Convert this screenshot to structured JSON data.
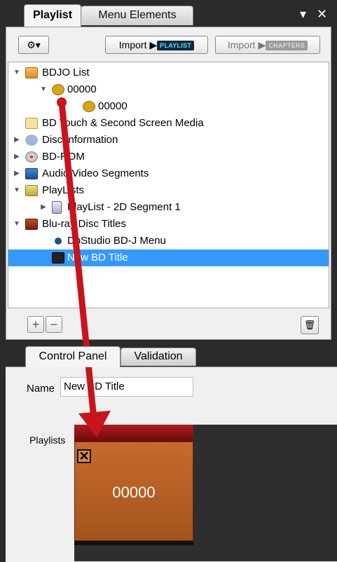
{
  "tabs": {
    "playlist": "Playlist",
    "menu_elements": "Menu Elements",
    "dropdown_glyph": "▾",
    "close_glyph": "✕"
  },
  "toolbar": {
    "gear_glyph": "⚙▾",
    "import_label": "Import",
    "import_playlist_tag": "PLAYLIST",
    "import_chapters_tag": "CHAPTERS"
  },
  "tree": {
    "bdjo_list": "BDJO List",
    "bdjo_00000": "00000",
    "bdjo_child_00000": "00000",
    "bd_touch": "BD Touch & Second Screen Media",
    "disc_information": "Disc Information",
    "bd_rom": "BD-ROM",
    "audio_video_segments": "Audio Video Segments",
    "playlists": "PlayLists",
    "playlist_2d": "PlayList - 2D Segment 1",
    "bluray_titles": "Blu-ray Disc Titles",
    "dostudio_menu": "DoStudio BD-J Menu",
    "new_bd_title": "New BD Title"
  },
  "bottom_buttons": {
    "add": "+",
    "remove": "−",
    "trash": "🗑"
  },
  "bottom_tabs": {
    "control_panel": "Control Panel",
    "validation": "Validation"
  },
  "properties": {
    "name_label": "Name",
    "name_value": "New BD Title",
    "playlists_label": "Playlists",
    "playlist_card_label": "00000",
    "card_close_glyph": "✕"
  },
  "colors": {
    "selection": "#3399ff",
    "arrow": "#c8141a",
    "card": "#c76a2c"
  }
}
